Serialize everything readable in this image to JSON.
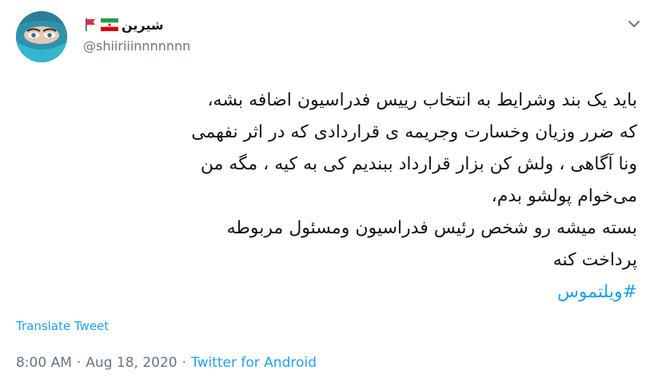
{
  "user": {
    "display_name": "شیرین",
    "handle": "@shiiriiinnnnnnn",
    "flags": [
      "red-flag-icon",
      "iran-flag-icon"
    ]
  },
  "tweet": {
    "lines": [
      "باید یک بند وشرایط به انتخاب رییس فدراسیون  اضافه بشه،",
      "که ضرر وزیان وخسارت وجریمه ی قراردادی که در اثر  نفهمی",
      "ونا آگاهی ، ولش کن بزار قرارداد ببندیم  کی به کیه ،  مگه من",
      "می‌خوام پولشو بدم،",
      "بسته میشه  رو شخص  رئیس فدراسیون ومسئول مربوطه",
      "پرداخت کنه"
    ],
    "hashtag": "#ویلتموس"
  },
  "translate_label": "Translate Tweet",
  "meta": {
    "time": "8:00 AM",
    "separator1": "·",
    "date": "Aug 18, 2020",
    "separator2": "·",
    "source": "Twitter for Android"
  },
  "colors": {
    "link": "#1da1f2",
    "secondary": "#657786",
    "text": "#14171a"
  }
}
